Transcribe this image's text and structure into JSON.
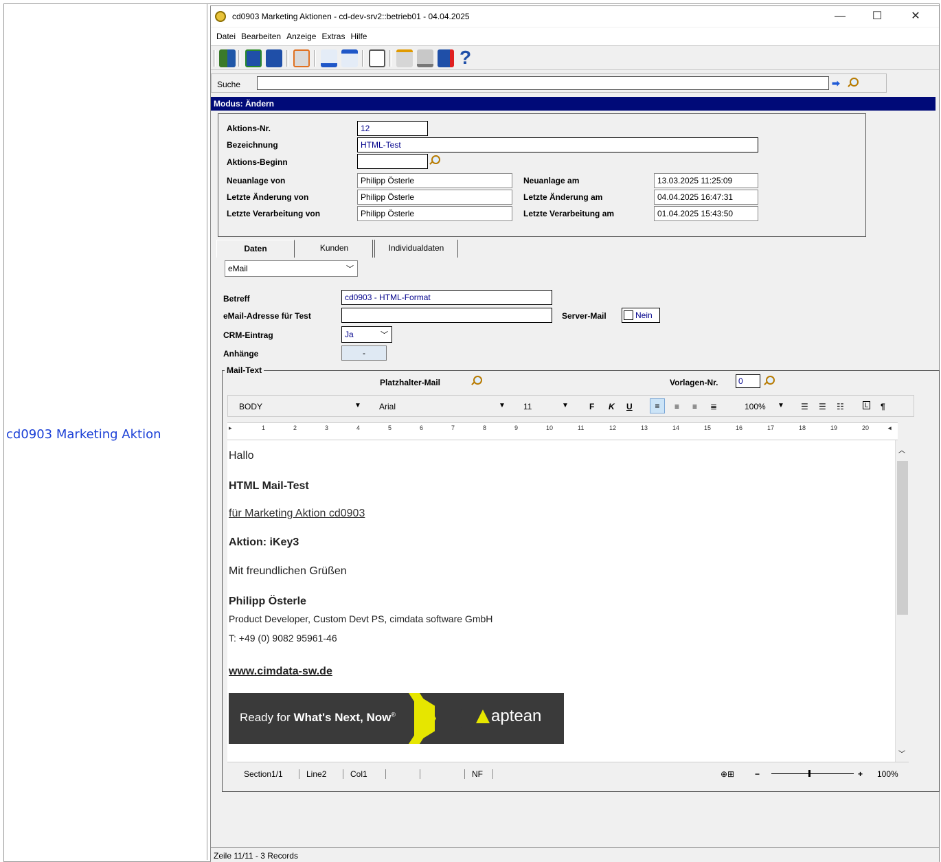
{
  "left_cell": {
    "link": "cd0903 Marketing Aktion"
  },
  "window": {
    "title": "cd0903 Marketing Aktionen - cd-dev-srv2::betrieb01 - 04.04.2025",
    "minimize": "—",
    "maximize": "☐",
    "close": "✕"
  },
  "menu": [
    "Datei",
    "Bearbeiten",
    "Anzeige",
    "Extras",
    "Hilfe"
  ],
  "search": {
    "label": "Suche",
    "value": ""
  },
  "modus": "Modus: Ändern",
  "header": {
    "aktions_nr_label": "Aktions-Nr.",
    "aktions_nr": "12",
    "bezeichnung_label": "Bezeichnung",
    "bezeichnung": "HTML-Test",
    "beginn_label": "Aktions-Beginn",
    "beginn": "",
    "neuanlage_von_label": "Neuanlage von",
    "neuanlage_von": "Philipp Österle",
    "letzte_aenderung_von_label": "Letzte Änderung von",
    "letzte_aenderung_von": "Philipp Österle",
    "letzte_verarbeitung_von_label": "Letzte Verarbeitung von",
    "letzte_verarbeitung_von": "Philipp Österle",
    "neuanlage_am_label": "Neuanlage am",
    "neuanlage_am": "13.03.2025 11:25:09",
    "letzte_aenderung_am_label": "Letzte Änderung am",
    "letzte_aenderung_am": "04.04.2025 16:47:31",
    "letzte_verarbeitung_am_label": "Letzte Verarbeitung am",
    "letzte_verarbeitung_am": "01.04.2025 15:43:50"
  },
  "tabs": [
    "Daten",
    "Kunden",
    "Individualdaten"
  ],
  "daten": {
    "type_select": "eMail",
    "betreff_label": "Betreff",
    "betreff": "cd0903 - HTML-Format",
    "test_email_label": "eMail-Adresse für Test",
    "test_email": "",
    "server_mail_label": "Server-Mail",
    "server_mail": "Nein",
    "crm_label": "CRM-Eintrag",
    "crm": "Ja",
    "anhaenge_label": "Anhänge",
    "anhaenge_button": "-",
    "mailtext_legend": "Mail-Text",
    "platzhalter_label": "Platzhalter-Mail",
    "vorlagen_label": "Vorlagen-Nr.",
    "vorlagen": "0"
  },
  "editor_toolbar": {
    "style": "BODY",
    "font": "Arial",
    "size": "11",
    "bold": "F",
    "italic": "K",
    "underline": "U",
    "zoom": "100%",
    "pilcrow": "¶"
  },
  "ruler": [
    "1",
    "2",
    "3",
    "4",
    "5",
    "6",
    "7",
    "8",
    "9",
    "10",
    "11",
    "12",
    "13",
    "14",
    "15",
    "16",
    "17",
    "18",
    "19",
    "20"
  ],
  "mail": {
    "greeting": "Hallo",
    "heading": "HTML Mail-Test",
    "subheading": "für Marketing Aktion cd0903",
    "aktion": "Aktion: iKey3",
    "closing": "Mit freundlichen Grüßen",
    "name": "Philipp Österle",
    "role": "Product Developer, Custom Devt PS, cimdata software GmbH",
    "phone": "T: +49 (0) 9082 95961-46",
    "website": "www.cimdata-sw.de",
    "banner_text_1": "Ready for",
    "banner_text_2": "What's Next, Now",
    "banner_reg": "®",
    "banner_logo": "aptean"
  },
  "editor_status": {
    "section": "Section1/1",
    "line": "Line2",
    "col": "Col1",
    "nf": "NF",
    "minus": "−",
    "plus": "+",
    "zoom": "100%"
  },
  "footer": "Zeile 11/11 - 3 Records"
}
